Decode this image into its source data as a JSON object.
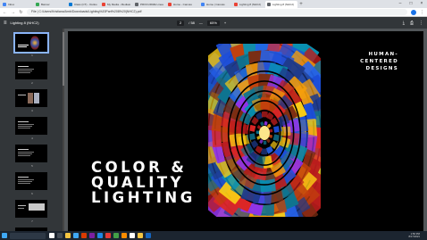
{
  "browser": {
    "tabs": [
      {
        "label": "Inbox",
        "color": "#4285f4",
        "active": false
      },
      {
        "label": "Banner",
        "color": "#34a853",
        "active": false
      },
      {
        "label": "Class (CT) - Outlook",
        "color": "#0078d4",
        "active": false
      },
      {
        "label": "My Media - Mediasite",
        "color": "#ea4335",
        "active": false
      },
      {
        "label": "PROCURIZE Lineage",
        "color": "#5f6368",
        "active": false
      },
      {
        "label": "Home - Canvas",
        "color": "#ea4335",
        "active": false
      },
      {
        "label": "Home | Canvas",
        "color": "#4285f4",
        "active": false
      },
      {
        "label": "Lighting 8 (NHC2)",
        "color": "#ea4335",
        "active": false
      },
      {
        "label": "Lighting 8 (NHC2)",
        "color": "#5f6368",
        "active": true
      }
    ],
    "window_controls": {
      "minimize": "–",
      "maximize": "□",
      "close": "×"
    },
    "nav": {
      "back": "←",
      "forward": "→",
      "reload": "↻"
    },
    "url": "File | C:/Users/Kristiana/Amb/Downloads/Lighting%20Part%208%20(NHC2).pdf"
  },
  "pdf_toolbar": {
    "menu_icon": "≡",
    "title": "Lighting 8 (NHC2)",
    "page_current": "2",
    "page_total": "/ 58",
    "zoom_minus": "—",
    "zoom": "65%",
    "zoom_plus": "+",
    "download_icon": "⤓",
    "print_icon": "⎙",
    "more_icon": "⋮"
  },
  "thumbnails": [
    {
      "num": "1",
      "variant": "window"
    },
    {
      "num": "2",
      "variant": "text"
    },
    {
      "num": "3",
      "variant": "panels"
    },
    {
      "num": "4",
      "variant": "text"
    },
    {
      "num": "5",
      "variant": "text"
    },
    {
      "num": "6",
      "variant": "text"
    },
    {
      "num": "7",
      "variant": "grey"
    },
    {
      "num": "8",
      "variant": "text"
    }
  ],
  "slide": {
    "headline_lines": [
      "COLOR &",
      "QUALITY",
      "LIGHTING"
    ],
    "tagline_lines": [
      "HUMAN-",
      "CENTERED",
      "DESIGNS"
    ]
  },
  "taskbar": {
    "search_placeholder": "",
    "app_colors": [
      "#ffffff",
      "#444c56",
      "#f4c542",
      "#3fa9f5",
      "#d83b01",
      "#7b1fa2",
      "#1e88e5",
      "#e53935",
      "#43a047",
      "#fb8c00",
      "#ffffff",
      "#f4c542",
      "#1565c0"
    ],
    "time": "1:56 PM",
    "date": "8/17/2021"
  }
}
